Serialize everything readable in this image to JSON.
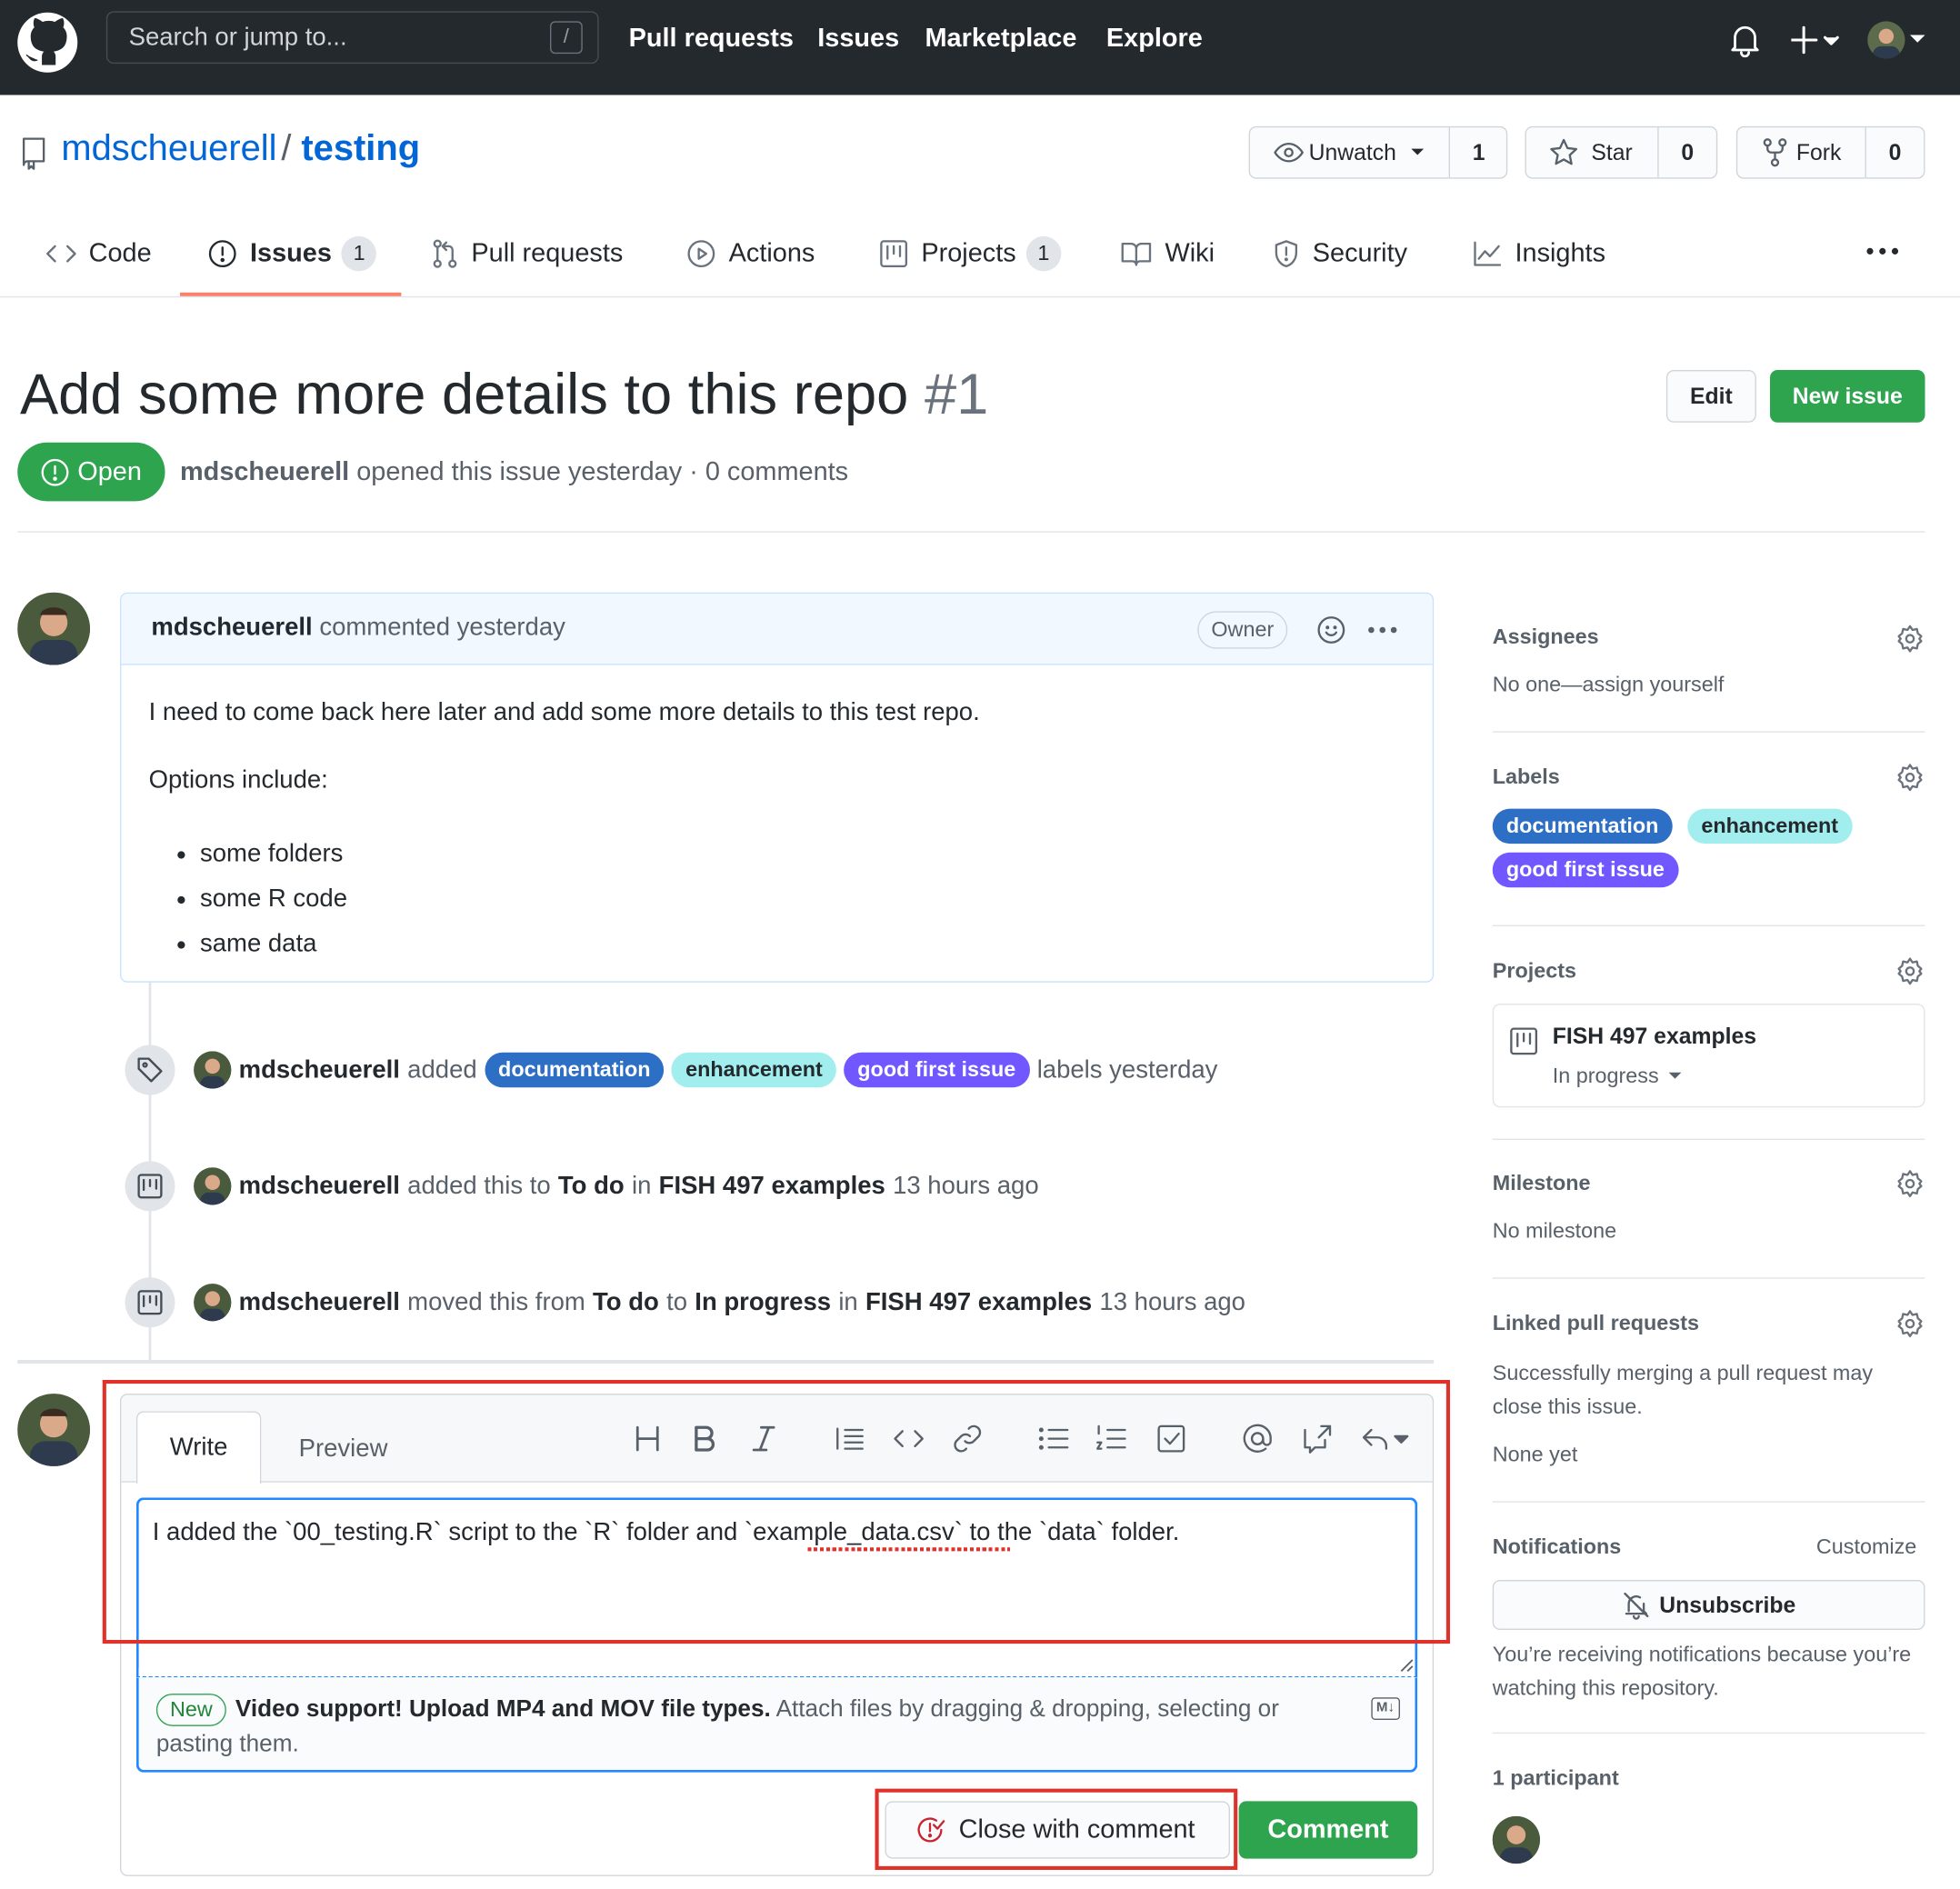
{
  "header": {
    "search_placeholder": "Search or jump to...",
    "search_key": "/",
    "nav": [
      "Pull requests",
      "Issues",
      "Marketplace",
      "Explore"
    ]
  },
  "repo": {
    "owner": "mdscheuerell",
    "separator": "/",
    "name": "testing",
    "watch_label": "Unwatch",
    "watch_count": "1",
    "star_label": "Star",
    "star_count": "0",
    "fork_label": "Fork",
    "fork_count": "0"
  },
  "tabs": {
    "code": "Code",
    "issues": "Issues",
    "issues_count": "1",
    "pulls": "Pull requests",
    "actions": "Actions",
    "projects": "Projects",
    "projects_count": "1",
    "wiki": "Wiki",
    "security": "Security",
    "insights": "Insights"
  },
  "issue": {
    "title": "Add some more details to this repo",
    "number": "#1",
    "edit_label": "Edit",
    "new_issue_label": "New issue",
    "state": "Open",
    "author": "mdscheuerell",
    "meta": "opened this issue yesterday · 0 comments"
  },
  "comment": {
    "author": "mdscheuerell",
    "when": "commented yesterday",
    "role": "Owner",
    "body_p1": "I need to come back here later and add some more details to this test repo.",
    "body_p2": "Options include:",
    "list": [
      "some folders",
      "some R code",
      "same data"
    ]
  },
  "timeline": {
    "ev1_user": "mdscheuerell",
    "ev1_verb": "added",
    "ev1_suffix": "labels yesterday",
    "ev2_user": "mdscheuerell",
    "ev2_t1": "added this to",
    "ev2_col": "To do",
    "ev2_t2": "in",
    "ev2_proj": "FISH 497 examples",
    "ev2_time": "13 hours ago",
    "ev3_user": "mdscheuerell",
    "ev3_t1": "moved this from",
    "ev3_from": "To do",
    "ev3_t2": "to",
    "ev3_to": "In progress",
    "ev3_t3": "in",
    "ev3_proj": "FISH 497 examples",
    "ev3_time": "13 hours ago"
  },
  "labels": [
    "documentation",
    "enhancement",
    "good first issue"
  ],
  "editor": {
    "tab_write": "Write",
    "tab_preview": "Preview",
    "text": "I added the `00_testing.R` script to the `R` folder and `example_data.csv` to the `data` folder.",
    "new_badge": "New",
    "notice_bold": "Video support! Upload MP4 and MOV file types.",
    "notice_rest": "Attach files by dragging & dropping, selecting or pasting them.",
    "md_badge": "M↓",
    "close_label": "Close with comment",
    "comment_label": "Comment"
  },
  "sidebar": {
    "assignees_title": "Assignees",
    "assignees_value": "No one—assign yourself",
    "labels_title": "Labels",
    "projects_title": "Projects",
    "project_name": "FISH 497 examples",
    "project_status": "In progress",
    "milestone_title": "Milestone",
    "milestone_value": "No milestone",
    "linked_title": "Linked pull requests",
    "linked_desc": "Successfully merging a pull request may close this issue.",
    "linked_value": "None yet",
    "notifications_title": "Notifications",
    "customize": "Customize",
    "unsubscribe": "Unsubscribe",
    "notif_desc": "You’re receiving notifications because you’re watching this repository.",
    "participants": "1 participant"
  },
  "colors": {
    "header_bg": "#24292e",
    "link": "#0366d6",
    "green": "#2ea44f",
    "label_documentation": "#2d6fc4",
    "label_enhancement": "#a2eeef",
    "label_good_first_issue": "#7057ff",
    "highlight": "#e0322b",
    "active_tab": "#f9826c"
  }
}
